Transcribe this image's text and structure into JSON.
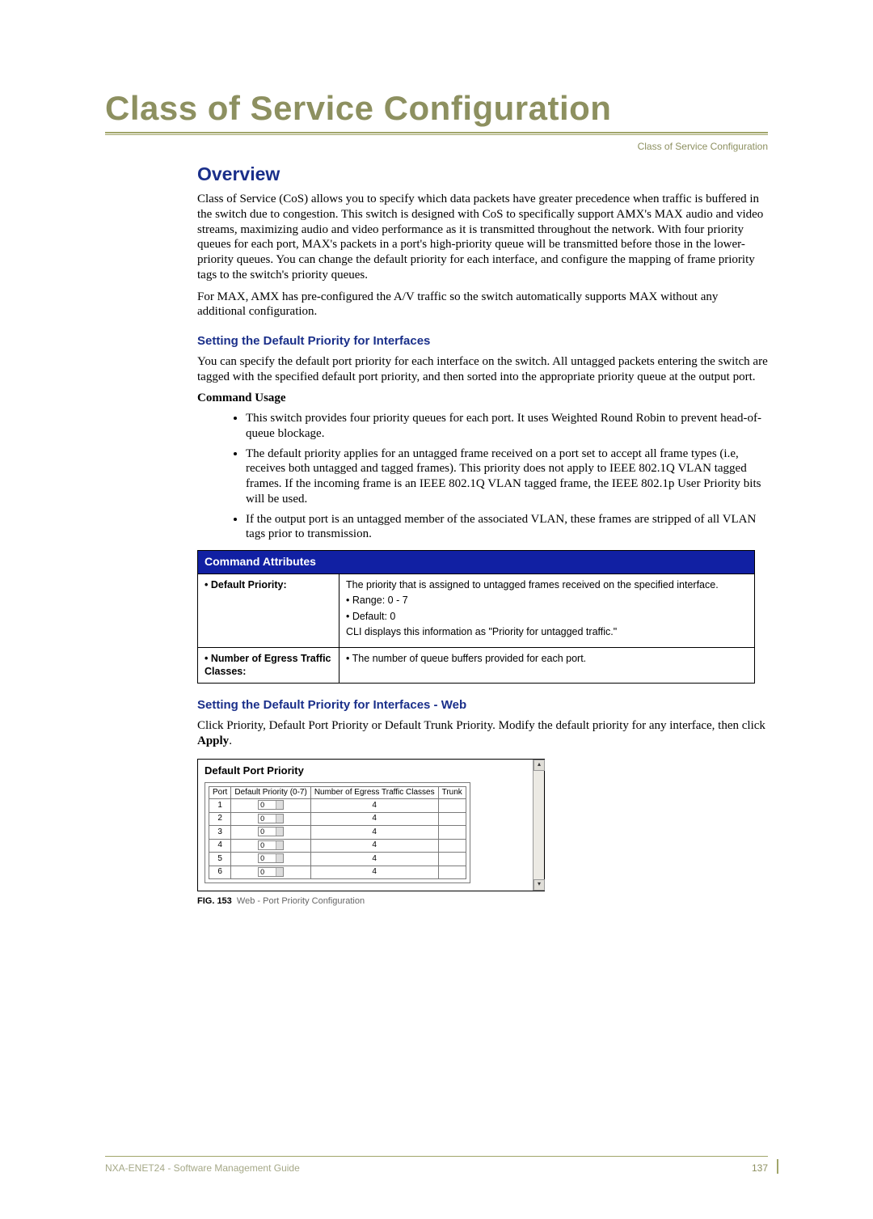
{
  "running_head": "Class of Service Configuration",
  "chapter_title": "Class of Service Configuration",
  "h2_overview": "Overview",
  "overview_p1": "Class of Service (CoS) allows you to specify which data packets have greater precedence when traffic is buffered in the switch due to congestion. This switch is designed with CoS to specifically support AMX's MAX audio and video streams, maximizing audio and video performance as it is transmitted throughout the network. With four priority queues for each port, MAX's packets in a port's high-priority queue will be transmitted before those in the lower-priority queues. You can change the default priority for each interface, and configure the mapping of frame priority tags to the switch's priority queues.",
  "overview_p2": "For MAX, AMX has pre-configured the A/V traffic so the switch automatically supports MAX without any additional configuration.",
  "h3_setting": "Setting the Default Priority for Interfaces",
  "setting_p1": "You can specify the default port priority for each interface on the switch. All untagged packets entering the switch are tagged with the specified default port priority, and then sorted into the appropriate priority queue at the output port.",
  "command_usage_label": "Command Usage",
  "usage_items": {
    "0": "This switch provides four priority queues for each port. It uses Weighted Round Robin to prevent head-of-queue blockage.",
    "1": "The default priority applies for an untagged frame received on a port set to accept all frame types (i.e, receives both untagged and tagged frames). This priority does not apply to IEEE 802.1Q VLAN tagged frames. If the incoming frame is an IEEE 802.1Q VLAN tagged frame, the IEEE 802.1p User Priority bits will be used.",
    "2": "If the output port is an untagged member of the associated VLAN, these frames are stripped of all VLAN tags prior to transmission."
  },
  "attr_table": {
    "header": "Command Attributes",
    "row1_label": "• Default Priority:",
    "row1_desc_line1": "The priority that is assigned to untagged frames received on the specified interface.",
    "row1_desc_line2": "Range: 0 - 7",
    "row1_desc_line3": "Default: 0",
    "row1_desc_line4": "CLI displays this information as \"Priority for untagged traffic.\"",
    "row2_label": "• Number of Egress Traffic Classes:",
    "row2_desc": "The number of queue buffers provided for each port."
  },
  "h3_setting_web": "Setting the Default Priority for Interfaces - Web",
  "setting_web_p1_part1": "Click Priority, Default Port Priority or Default Trunk Priority. Modify the default priority for any interface, then click ",
  "setting_web_apply": "Apply",
  "setting_web_p1_part2": ".",
  "figure": {
    "panel_title": "Default Port Priority",
    "col_port": "Port",
    "col_default_priority": "Default Priority (0-7)",
    "col_num_egress": "Number of Egress Traffic Classes",
    "col_trunk": "Trunk",
    "rows": {
      "0": {
        "port": "1",
        "priority": "0",
        "egress": "4"
      },
      "1": {
        "port": "2",
        "priority": "0",
        "egress": "4"
      },
      "2": {
        "port": "3",
        "priority": "0",
        "egress": "4"
      },
      "3": {
        "port": "4",
        "priority": "0",
        "egress": "4"
      },
      "4": {
        "port": "5",
        "priority": "0",
        "egress": "4"
      },
      "5": {
        "port": "6",
        "priority": "0",
        "egress": "4"
      }
    },
    "caption_num": "FIG. 153",
    "caption_text": "Web - Port Priority Configuration"
  },
  "footer_text": "NXA-ENET24 - Software Management Guide",
  "page_number": "137"
}
